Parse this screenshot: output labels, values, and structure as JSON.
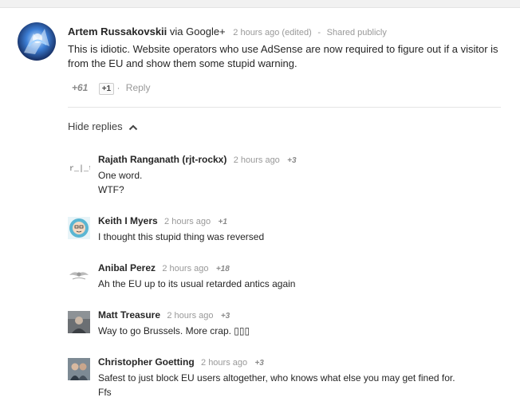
{
  "comment": {
    "author": "Artem Russakovskii",
    "via": "via Google+",
    "time": "2 hours ago (edited)",
    "separator": "-",
    "visibility": "Shared publicly",
    "text": "This is idiotic. Website operators who use AdSense are now required to figure out if a visitor is from the EU and show them some stupid warning.",
    "plus_count": "+61",
    "plus_button": "+1",
    "separator2": "·",
    "reply_label": "Reply",
    "avatar_icon": "blue-figure-avatar"
  },
  "hide_replies": {
    "label": "Hide replies",
    "icon": "chevron-up-icon"
  },
  "replies": [
    {
      "name": "Rajath Ranganath (rjt-rockx)",
      "time": "2 hours ago",
      "plus": "+3",
      "line1": "One word.",
      "line2": "WTF?",
      "avatar_icon": "rjt-logo-avatar",
      "avatar_text": "r_|_t"
    },
    {
      "name": "Keith I Myers",
      "time": "2 hours ago",
      "plus": "+1",
      "line1": "I thought this stupid thing was reversed",
      "line2": "",
      "avatar_icon": "cartoon-face-avatar"
    },
    {
      "name": "Anibal Perez",
      "time": "2 hours ago",
      "plus": "+18",
      "line1": "Ah the EU up to its usual retarded antics again",
      "line2": "",
      "avatar_icon": "winged-emblem-avatar"
    },
    {
      "name": "Matt Treasure",
      "time": "2 hours ago",
      "plus": "+3",
      "line1": "Way to go Brussels. More crap. ▯▯▯",
      "line2": "",
      "avatar_icon": "photo-avatar"
    },
    {
      "name": "Christopher Goetting",
      "time": "2 hours ago",
      "plus": "+3",
      "line1": "Safest to just block EU users altogether, who knows what else you may get fined for.",
      "line2": "Ffs",
      "avatar_icon": "couple-photo-avatar"
    }
  ]
}
